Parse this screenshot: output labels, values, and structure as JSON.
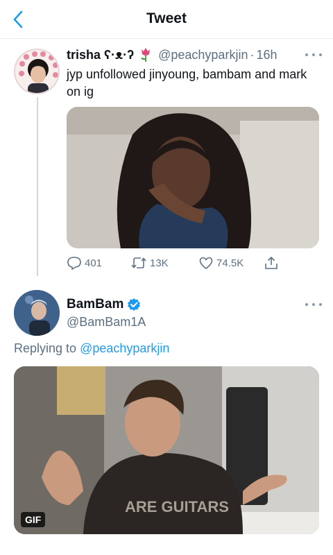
{
  "header": {
    "title": "Tweet"
  },
  "tweet1": {
    "name": "trisha ʕ·ᴥ·ʔ",
    "handle": "@peachyparkjin",
    "separator": "·",
    "time": "16h",
    "text": "jyp unfollowed jinyoung, bambam and mark on ig",
    "stats": {
      "replies": "401",
      "retweets": "13K",
      "likes": "74.5K"
    }
  },
  "tweet2": {
    "name": "BamBam",
    "handle": "@BamBam1A",
    "replying_prefix": "Replying to",
    "replying_to": "@peachyparkjin",
    "gif_label": "GIF"
  },
  "colors": {
    "accent": "#1d9bf0",
    "muted": "#5b7083",
    "border": "#e6ecf0"
  },
  "icons": [
    "chevron-left-icon",
    "tulip-emoji-icon",
    "more-icon",
    "reply-icon",
    "retweet-icon",
    "like-icon",
    "share-icon",
    "verified-badge-icon"
  ]
}
